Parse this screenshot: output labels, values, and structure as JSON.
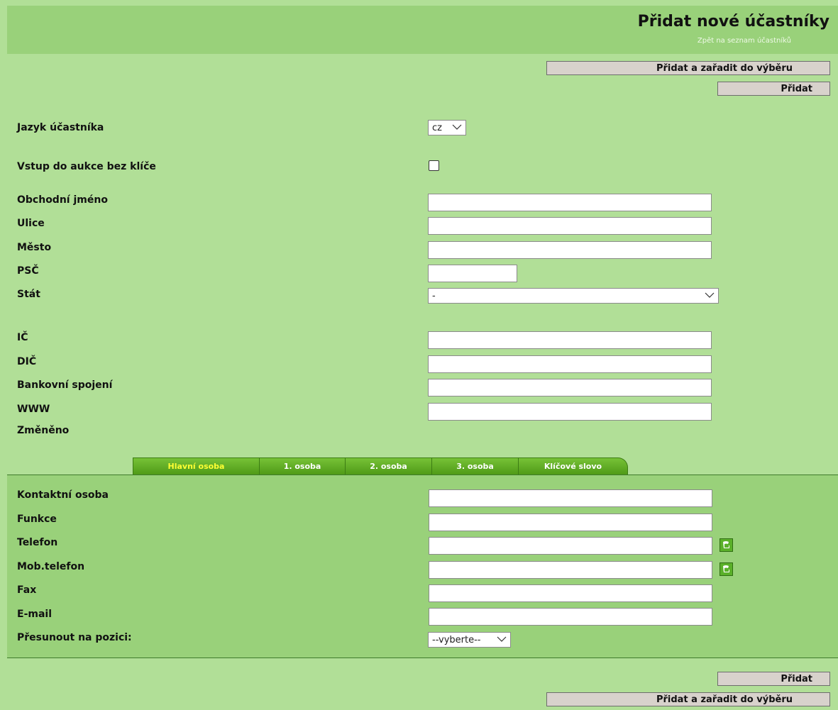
{
  "header": {
    "title": "Přidat nové účastníky",
    "back_link": "Zpět na seznam účastníků"
  },
  "buttons": {
    "add_and_select": "Přidat a zařadit do výběru",
    "add": "Přidat"
  },
  "form": {
    "language_label": "Jazyk účastníka",
    "language_value": "cz",
    "no_key_label": "Vstup do aukce bez klíče",
    "no_key_checked": false,
    "business_name_label": "Obchodní jméno",
    "street_label": "Ulice",
    "city_label": "Město",
    "zip_label": "PSČ",
    "country_label": "Stát",
    "country_value": "-",
    "ic_label": "IČ",
    "dic_label": "DIČ",
    "bank_label": "Bankovní spojení",
    "www_label": "WWW",
    "changed_label": "Změněno"
  },
  "tabs": [
    {
      "label": "Hlavní osoba",
      "active": true
    },
    {
      "label": "1. osoba",
      "active": false
    },
    {
      "label": "2. osoba",
      "active": false
    },
    {
      "label": "3. osoba",
      "active": false
    },
    {
      "label": "Klíčové slovo",
      "active": false
    }
  ],
  "person": {
    "contact_label": "Kontaktní osoba",
    "function_label": "Funkce",
    "phone_label": "Telefon",
    "mobile_label": "Mob.telefon",
    "fax_label": "Fax",
    "email_label": "E-mail",
    "move_label": "Přesunout na pozici:",
    "move_value": "--vyberte--"
  },
  "colors": {
    "background": "#b1df97",
    "header": "#99d17a",
    "tab": "#5eaa1f",
    "active_tab_text": "#ffff33"
  }
}
